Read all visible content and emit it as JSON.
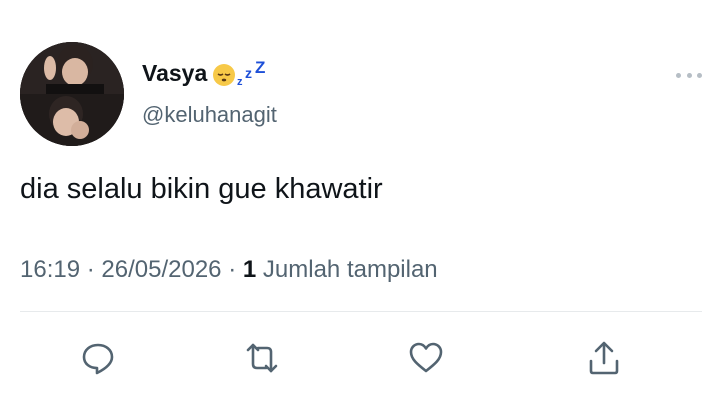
{
  "user": {
    "display_name": "Vasya",
    "name_emoji_icons": [
      "sleeping-face-icon",
      "zzz-icon"
    ],
    "handle": "@keluhanagit"
  },
  "tweet": {
    "text": "dia selalu bikin gue khawatir",
    "time": "16:19",
    "separator": "·",
    "date": "26/05/2026",
    "view_count": "1",
    "view_label": "Jumlah tampilan"
  },
  "actions": [
    {
      "name": "reply",
      "icon": "reply-icon"
    },
    {
      "name": "retweet",
      "icon": "retweet-icon"
    },
    {
      "name": "like",
      "icon": "heart-icon"
    },
    {
      "name": "share",
      "icon": "share-icon"
    }
  ],
  "colors": {
    "text_primary": "#0f1419",
    "text_secondary": "#536471",
    "icon": "#536471",
    "divider": "#e7eaec",
    "emoji_yellow": "#f7c948",
    "zzz_blue": "#1d4fd8"
  }
}
